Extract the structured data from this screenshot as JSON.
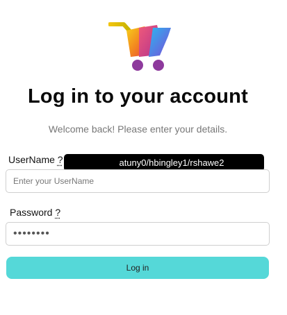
{
  "header": {
    "logo_icon": "shopping-cart-icon",
    "title": "Log in to your account",
    "subtitle": "Welcome back! Please enter your details."
  },
  "form": {
    "username_label": "UserName",
    "username_help": "?",
    "username_placeholder": "Enter your UserName",
    "username_tooltip": "atuny0/hbingley1/rshawe2",
    "password_label": "Password",
    "password_help": "?",
    "password_value": "••••••••",
    "login_label": "Log in"
  },
  "colors": {
    "accent": "#55d8d8",
    "tooltip_bg": "#000000"
  }
}
